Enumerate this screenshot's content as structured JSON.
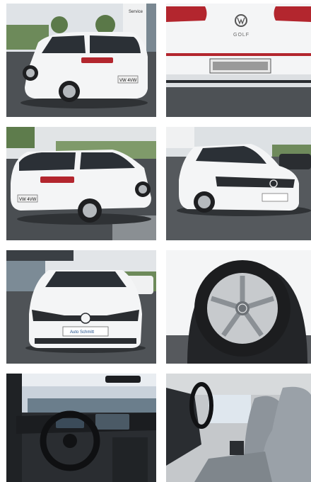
{
  "photos": [
    {
      "name": "rear-three-quarter-left",
      "signs": [
        "Service"
      ],
      "plate": "VW 4VW"
    },
    {
      "name": "rear-close-up",
      "badge": "GOLF"
    },
    {
      "name": "rear-three-quarter-left-2",
      "plate": "VW 4VW"
    },
    {
      "name": "front-three-quarter-right"
    },
    {
      "name": "front-view",
      "plate_label": "Auto Schmitt"
    },
    {
      "name": "wheel-close-up"
    },
    {
      "name": "cockpit-interior"
    },
    {
      "name": "front-seats-interior"
    }
  ],
  "colors": {
    "body_white": "#f4f5f6",
    "asphalt": "#4d5155",
    "sky": "#dfe3e7",
    "glass": "#2b3036",
    "taillight": "#b3262e",
    "interior_dark": "#2a2d31",
    "seat_grey": "#8d949b"
  }
}
